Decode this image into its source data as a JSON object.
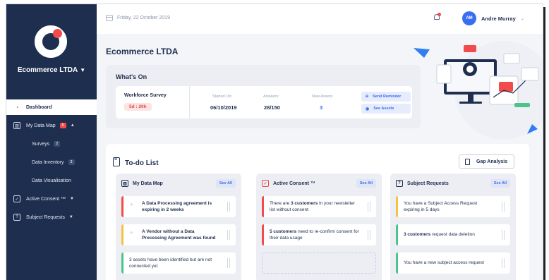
{
  "app": {
    "company": "Ecommerce LTDA",
    "page_title": "Ecommerce LTDA"
  },
  "topbar": {
    "date": "Friday, 22 October 2019",
    "user_initials": "AM",
    "user_name": "Andre Murray"
  },
  "sidebar": {
    "items": [
      {
        "label": "Dashboard",
        "icon": "gauge-icon",
        "active": true
      },
      {
        "label": "My Data Map",
        "icon": "chart-icon",
        "badge": "5"
      },
      {
        "label": "Surveys",
        "count": "2"
      },
      {
        "label": "Data Inventory",
        "count": "3"
      },
      {
        "label": "Data Visualisation"
      },
      {
        "label": "Active Consent ™",
        "icon": "checkbox-icon"
      },
      {
        "label": "Subject Requests",
        "icon": "question-box-icon"
      }
    ]
  },
  "whats_on": {
    "title": "What's On",
    "survey": {
      "name": "Workforce Survey",
      "timer": "5d : 20h",
      "started_label": "Started On:",
      "started_value": "06/10/2019",
      "answers_label": "Answers:",
      "answers_value": "28/150",
      "assets_label": "New Assets:",
      "assets_value": "3",
      "send_reminder": "Send Reminder",
      "see_assets": "See Assets"
    }
  },
  "todo": {
    "title": "To-do List",
    "gap_analysis": "Gap Analysis",
    "columns": [
      {
        "title": "My Data Map",
        "see_all": "See All",
        "cards": [
          {
            "text": "A Data Processing agreement is expiring in 2 weeks",
            "accent": "red"
          },
          {
            "text": "A Vendor without a Data Processing Agreement was found",
            "accent": "yellow"
          },
          {
            "text": "3 assets have been identified but are not connected yet",
            "accent": "green"
          }
        ]
      },
      {
        "title": "Active Consent ™",
        "see_all": "See All",
        "cards": [
          {
            "pre": "There are ",
            "bold": "3 customers",
            "post": " in your newsletter list without consent",
            "accent": "red"
          },
          {
            "pre": "",
            "bold": "5 customers",
            "post": " need to re-confirm consent for their data usage",
            "accent": "red"
          }
        ]
      },
      {
        "title": "Subject Requests",
        "see_all": "See All",
        "cards": [
          {
            "text": "You have a Subject Access Request expiring in 5 days",
            "accent": "yellow"
          },
          {
            "pre": "",
            "bold": "3 customers",
            "post": " request data deletion",
            "accent": "green"
          },
          {
            "text": "You have a new subject access request",
            "accent": "green"
          }
        ]
      }
    ]
  },
  "colors": {
    "sidebar": "#1d2e4f",
    "accent_red": "#f14b4b",
    "accent_blue": "#3b6df0",
    "accent_yellow": "#f5c242",
    "accent_green": "#4cc38a"
  }
}
